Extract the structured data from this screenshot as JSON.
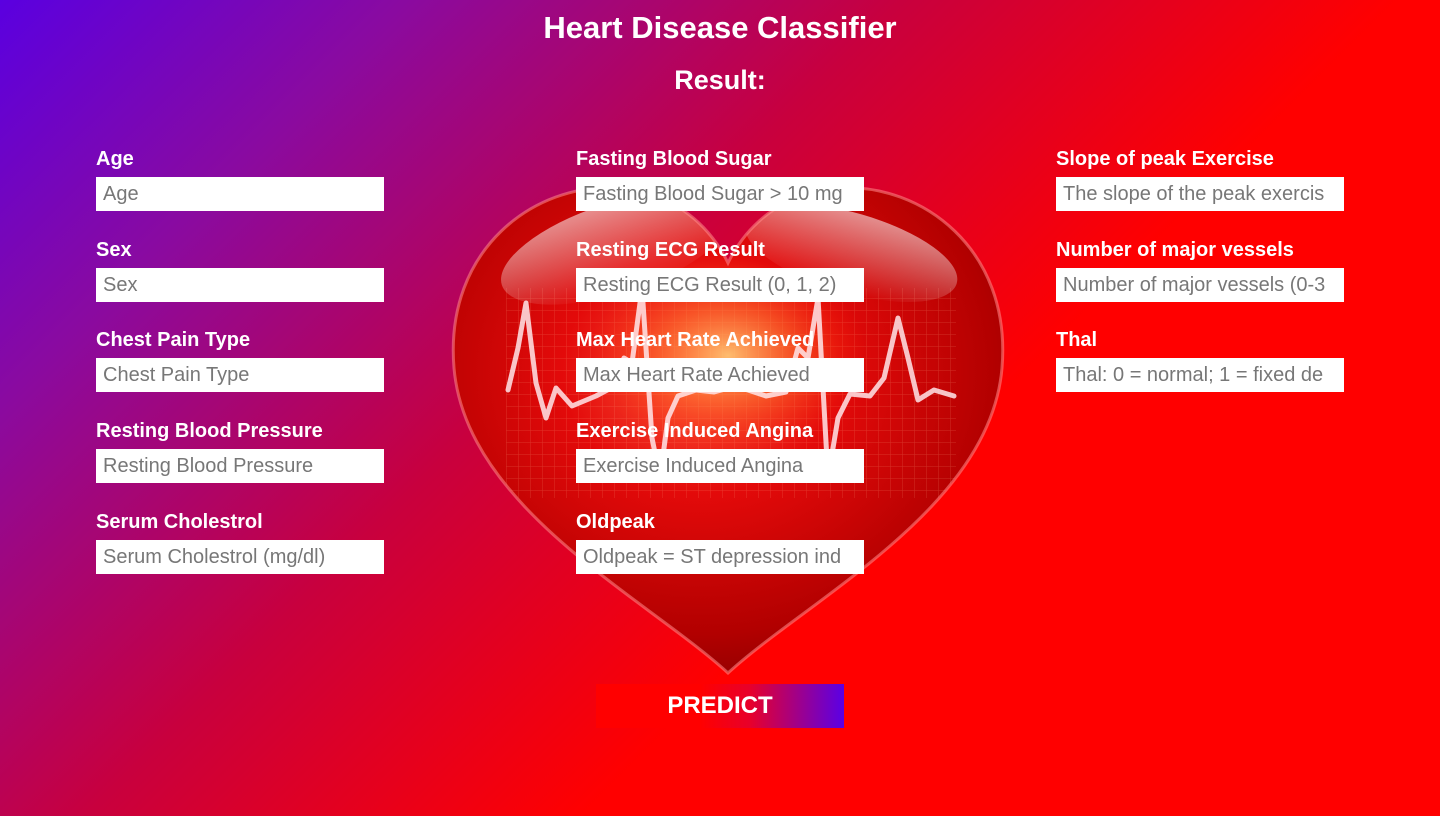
{
  "app": {
    "title": "Heart Disease Classifier",
    "result_label": "Result:"
  },
  "form": {
    "fields": [
      {
        "label": "Age",
        "placeholder": "Age",
        "value": ""
      },
      {
        "label": "Sex",
        "placeholder": "Sex",
        "value": ""
      },
      {
        "label": "Chest Pain Type",
        "placeholder": "Chest Pain Type",
        "value": ""
      },
      {
        "label": "Resting Blood Pressure",
        "placeholder": "Resting Blood Pressure",
        "value": ""
      },
      {
        "label": "Serum Cholestrol",
        "placeholder": "Serum Cholestrol (mg/dl)",
        "value": ""
      },
      {
        "label": "Fasting Blood Sugar",
        "placeholder": "Fasting Blood Sugar > 10 mg",
        "value": ""
      },
      {
        "label": "Resting ECG Result",
        "placeholder": "Resting ECG Result (0, 1, 2)",
        "value": ""
      },
      {
        "label": "Max Heart Rate Achieved",
        "placeholder": "Max Heart Rate Achieved",
        "value": ""
      },
      {
        "label": "Exercise Induced Angina",
        "placeholder": "Exercise Induced Angina",
        "value": ""
      },
      {
        "label": "Oldpeak",
        "placeholder": "Oldpeak = ST depression ind",
        "value": ""
      },
      {
        "label": "Slope of peak Exercise",
        "placeholder": "The slope of the peak exercis",
        "value": ""
      },
      {
        "label": "Number of major vessels",
        "placeholder": "Number of major vessels (0-3",
        "value": ""
      },
      {
        "label": "Thal",
        "placeholder": "Thal: 0 = normal; 1 = fixed de",
        "value": ""
      }
    ],
    "submit_label": "PREDICT"
  },
  "icons": {
    "background_image": "heart-ecg-icon"
  },
  "colors": {
    "gradient_start": "#5a00e0",
    "gradient_end": "#ff0000",
    "button_accent": "#5a00e6"
  }
}
